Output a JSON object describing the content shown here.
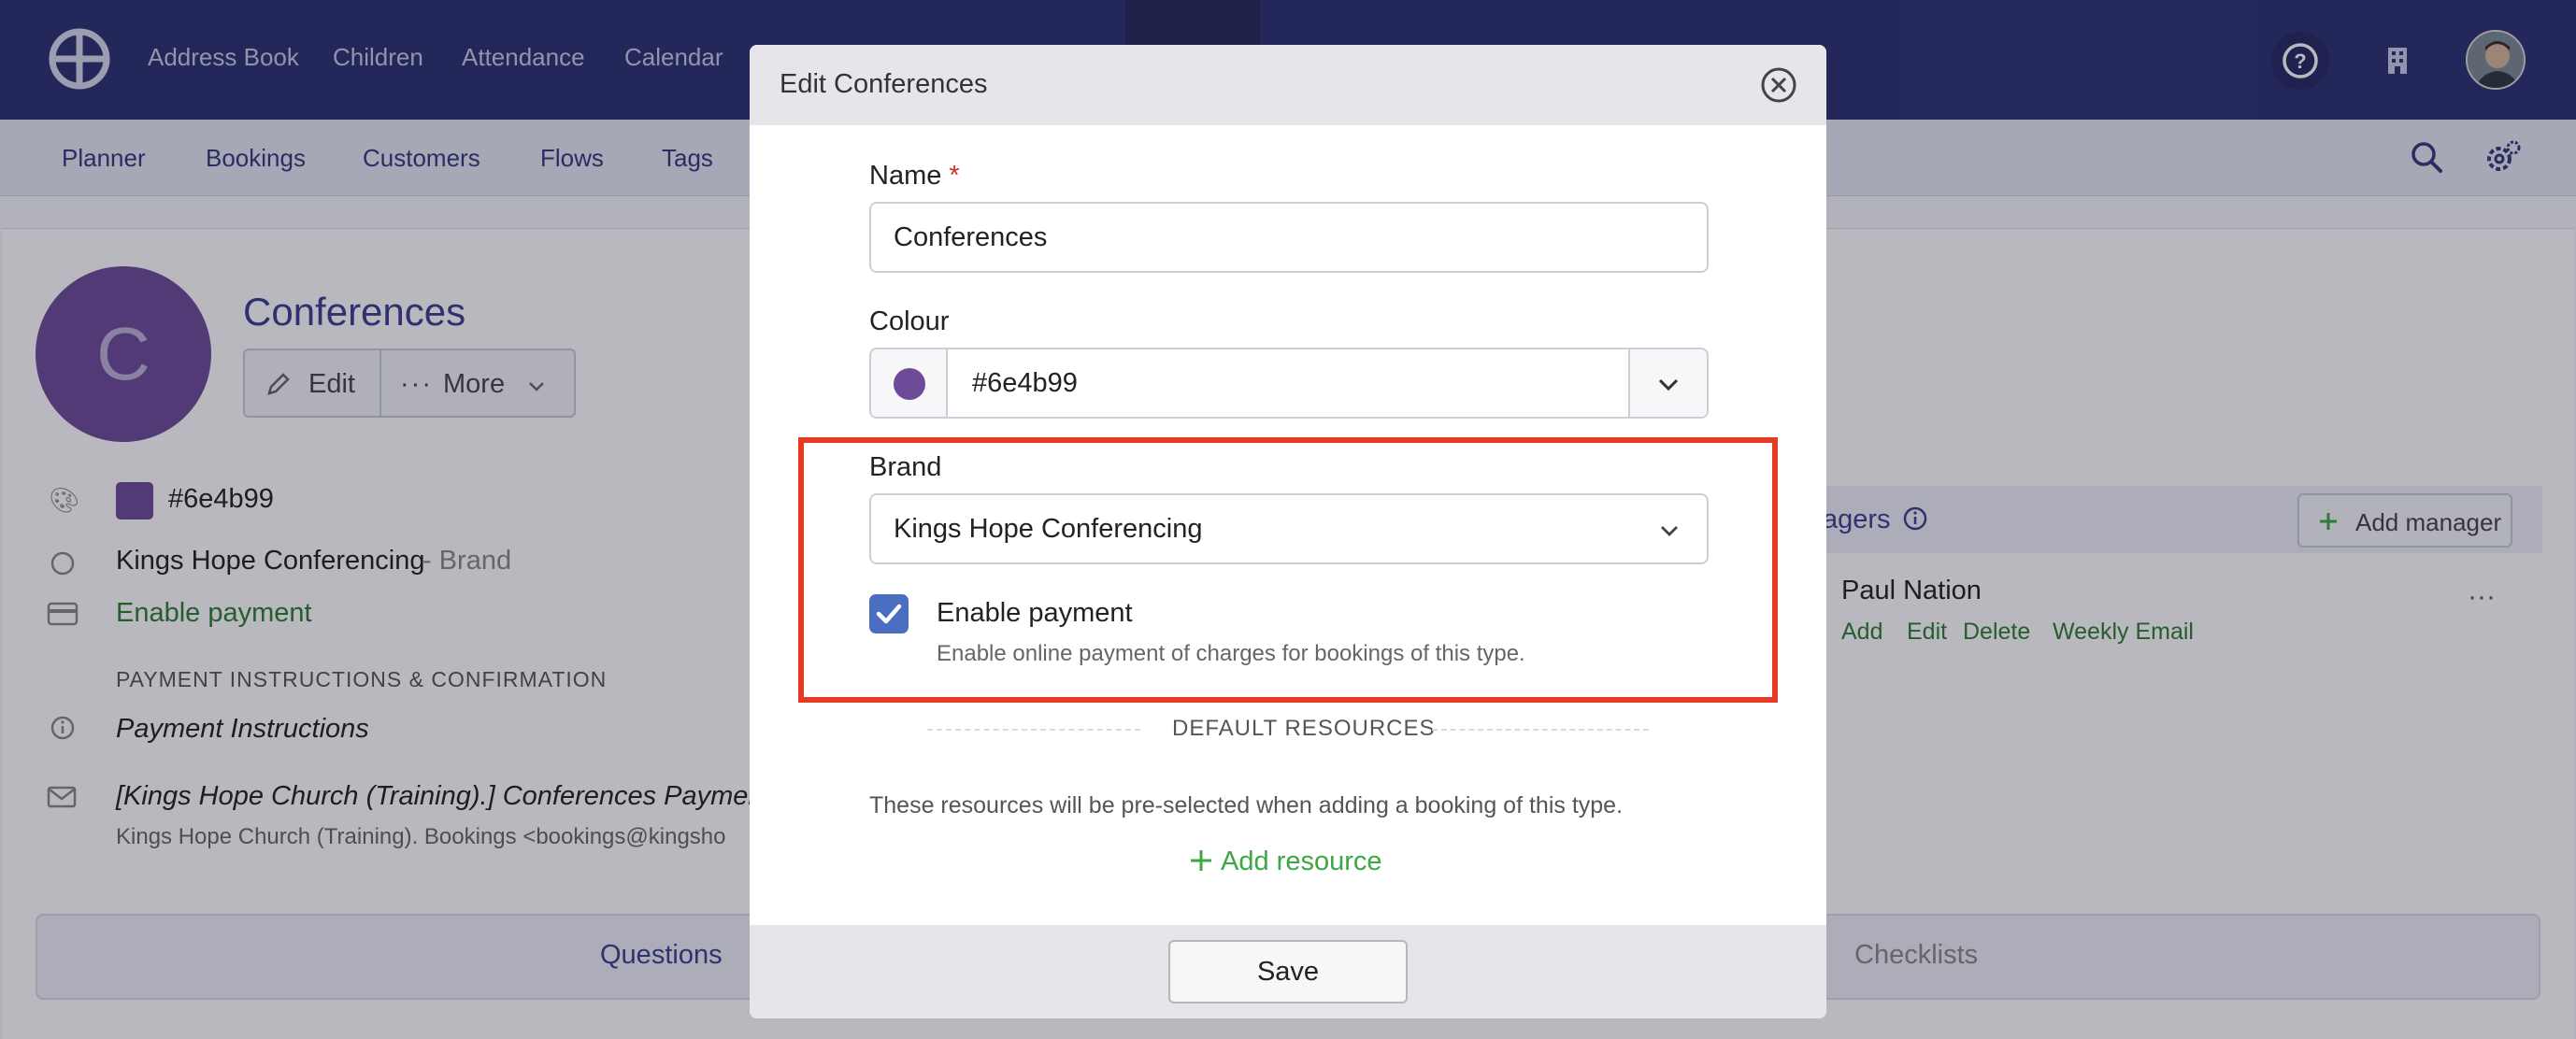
{
  "topnav": {
    "items": [
      "Address Book",
      "Children",
      "Attendance",
      "Calendar"
    ]
  },
  "subnav": {
    "items": [
      "Planner",
      "Bookings",
      "Customers",
      "Flows",
      "Tags"
    ]
  },
  "background": {
    "avatar_initial": "C",
    "title": "Conferences",
    "edit_label": "Edit",
    "more_label": "More",
    "colour_value": "#6e4b99",
    "brand_name": "Kings Hope Conferencing",
    "brand_suffix": "- Brand",
    "payment_status": "Enable payment",
    "payment_section_label": "PAYMENT INSTRUCTIONS & CONFIRMATION",
    "payment_instructions": "Payment Instructions",
    "email_subject": "[Kings Hope Church (Training).] Conferences Payment",
    "email_sender": "Kings Hope Church (Training). Bookings <bookings@kingsho",
    "managers_title": "agers",
    "add_manager_label": "Add manager",
    "manager_name": "Paul Nation",
    "manager_links": [
      "Add",
      "Edit",
      "Delete",
      "Weekly Email"
    ],
    "tabs": [
      "Questions",
      "Checklists"
    ]
  },
  "modal": {
    "title": "Edit Conferences",
    "name_label": "Name",
    "required_mark": "*",
    "name_value": "Conferences",
    "colour_label": "Colour",
    "colour_value": "#6e4b99",
    "brand_label": "Brand",
    "brand_value": "Kings Hope Conferencing",
    "enable_payment_label": "Enable payment",
    "enable_payment_checked": true,
    "enable_payment_help": "Enable online payment of charges for bookings of this type.",
    "default_resources_label": "DEFAULT RESOURCES",
    "resources_help": "These resources will be pre-selected when adding a booking of this type.",
    "add_resource_label": "Add resource",
    "save_label": "Save"
  },
  "colors": {
    "topnav_bg": "#2c3070",
    "brand_purple": "#6e4b99",
    "checkbox_blue": "#4a6fc1",
    "highlight_red": "#e53b26",
    "success_green": "#39a845"
  }
}
